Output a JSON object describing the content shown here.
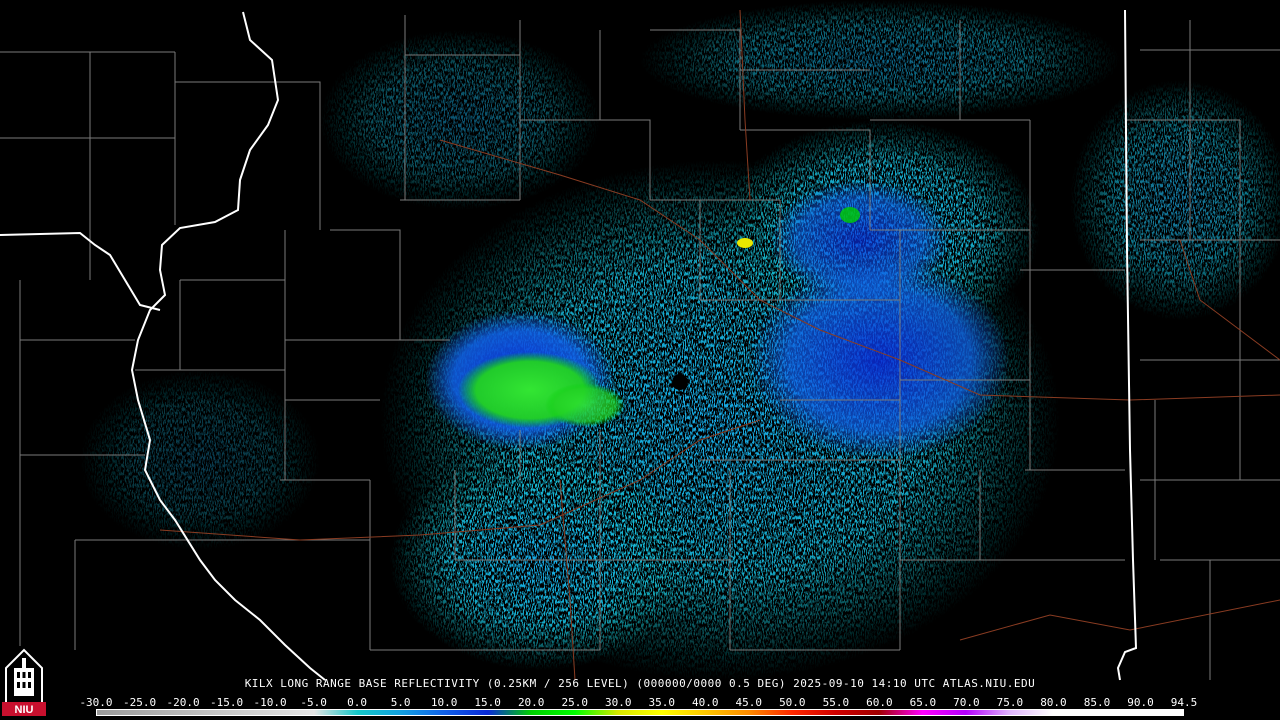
{
  "product_caption": "KILX LONG RANGE BASE REFLECTIVITY (0.25KM / 256 LEVEL) (000000/0000 0.5 DEG) 2025-09-10 14:10 UTC  ATLAS.NIU.EDU",
  "logo_text": "NIU",
  "scale": {
    "labels": [
      "-30.0",
      "-25.0",
      "-20.0",
      "-15.0",
      "-10.0",
      "-5.0",
      "0.0",
      "5.0",
      "10.0",
      "15.0",
      "20.0",
      "25.0",
      "30.0",
      "35.0",
      "40.0",
      "45.0",
      "50.0",
      "55.0",
      "60.0",
      "65.0",
      "70.0",
      "75.0",
      "80.0",
      "85.0",
      "90.0",
      "94.5"
    ],
    "colors": [
      "#9a9a9a",
      "#a9a9a9",
      "#b8b8b8",
      "#c8c8c8",
      "#d6d6d6",
      "#e3e3e3",
      "#14c8c8",
      "#12a0e0",
      "#1060e8",
      "#0a2ad8",
      "#00d000",
      "#00ff00",
      "#d8e800",
      "#ffff00",
      "#ffc800",
      "#ff8c00",
      "#ff2800",
      "#d00000",
      "#a00000",
      "#ff00ff",
      "#b400ff",
      "#e0b4ff",
      "#ffffff",
      "#ffffff",
      "#ffffff",
      "#ffffff"
    ]
  },
  "colors": {
    "background": "#000000",
    "county_lines": "#7a7a7a",
    "state_lines": "#ffffff",
    "highways": "#8a3c22"
  }
}
